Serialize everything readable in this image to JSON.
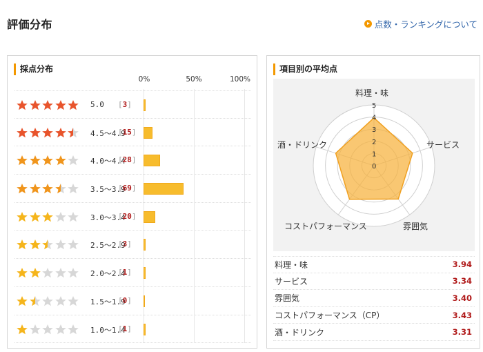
{
  "page_title": "評価分布",
  "about_link": "点数・ランキングについて",
  "distribution": {
    "heading": "採点分布",
    "pct_axis": [
      "0%",
      "50%",
      "100%"
    ],
    "rows": [
      {
        "range": "5.0",
        "count": "3",
        "pct": 1.7,
        "stars": 5.0
      },
      {
        "range": "4.5～4.9",
        "count": "15",
        "pct": 8.6,
        "stars": 4.5
      },
      {
        "range": "4.0～4.4",
        "count": "28",
        "pct": 16.1,
        "stars": 4.0
      },
      {
        "range": "3.5～3.9",
        "count": "69",
        "pct": 39.7,
        "stars": 3.5
      },
      {
        "range": "3.0～3.4",
        "count": "20",
        "pct": 11.5,
        "stars": 3.0
      },
      {
        "range": "2.5～2.9",
        "count": "3",
        "pct": 1.7,
        "stars": 2.5
      },
      {
        "range": "2.0～2.4",
        "count": "1",
        "pct": 0.6,
        "stars": 2.0
      },
      {
        "range": "1.5～1.9",
        "count": "0",
        "pct": 0.0,
        "stars": 1.5
      },
      {
        "range": "1.0～1.4",
        "count": "1",
        "pct": 0.6,
        "stars": 1.0
      }
    ],
    "colors": {
      "star_high": "#e8542c",
      "star_mid": "#f0951c",
      "star_low": "#f5b51c",
      "star_empty": "#d7d7d7",
      "bar": "#f7bc2d"
    }
  },
  "averages": {
    "heading": "項目別の平均点",
    "radar_ticks": [
      "0",
      "1",
      "2",
      "3",
      "4",
      "5"
    ],
    "radar_max": 5,
    "radar_labels": [
      "料理・味",
      "サービス",
      "雰囲気",
      "コストパフォーマンス",
      "酒・ドリンク"
    ],
    "items": [
      {
        "label": "料理・味",
        "value": "3.94"
      },
      {
        "label": "サービス",
        "value": "3.34"
      },
      {
        "label": "雰囲気",
        "value": "3.40"
      },
      {
        "label": "コストパフォーマンス（CP）",
        "value": "3.43"
      },
      {
        "label": "酒・ドリンク",
        "value": "3.31"
      }
    ]
  }
}
